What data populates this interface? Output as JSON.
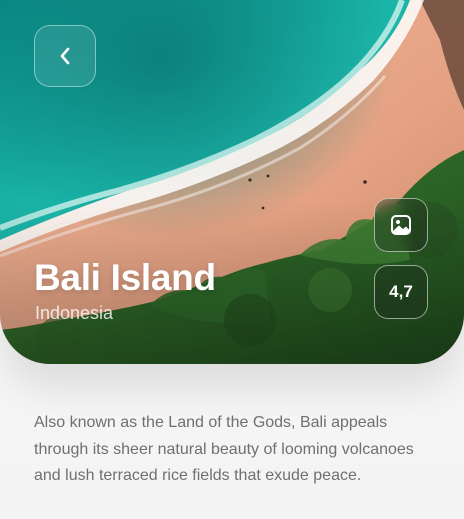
{
  "destination": {
    "name": "Bali Island",
    "country": "Indonesia",
    "rating": "4,7",
    "description": "Also known as the Land of the Gods, Bali appeals through its sheer natural beauty of looming volcanoes and lush terraced rice fields that exude peace."
  },
  "icons": {
    "back": "chevron-left-icon",
    "gallery": "image-icon"
  },
  "colors": {
    "sea": "#1bb3a8",
    "sand": "#e9a98c",
    "foliage": "#2f6a2a",
    "text_muted": "#6f6f74"
  }
}
